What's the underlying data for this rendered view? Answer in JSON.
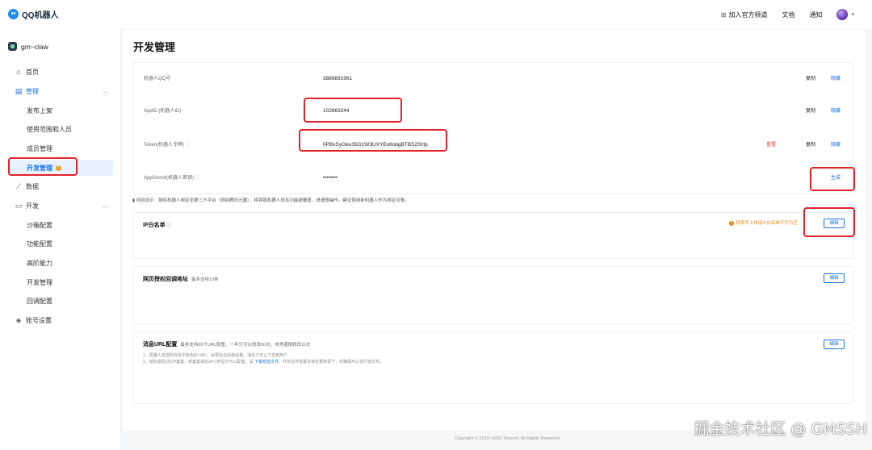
{
  "app": {
    "brand": "QQ机器人"
  },
  "topnav": {
    "join_channel": "加入官方频道",
    "docs": "文档",
    "notifications": "通知"
  },
  "sidebar": {
    "app_name": "gm~claw",
    "items": {
      "home": "首页",
      "manage": "管理",
      "publish": "发布上架",
      "scope": "使用范围和人员",
      "members": "成员管理",
      "dev_manage": "开发管理",
      "data": "数据",
      "dev": "开发",
      "sandbox": "沙箱配置",
      "features": "功能配置",
      "advanced": "高阶能力",
      "dev_manage_2": "开发管理",
      "callback": "回调配置",
      "account": "账号设置"
    },
    "dev_manage_badge": "!"
  },
  "page": {
    "title": "开发管理",
    "fields": [
      {
        "label": "机器人QQ号",
        "value": "3889891961",
        "copy": "复制",
        "hide": "隐藏"
      },
      {
        "label": "AppID (机器人ID)",
        "value": "102863244",
        "copy": "复制",
        "hide": "隐藏"
      },
      {
        "label": "Token(机器人令牌)",
        "value": "0PBxSyOeu35G1W3UXYEx6obgBTBS2SHp",
        "reset": "重置",
        "copy": "复制",
        "hide": "隐藏"
      },
      {
        "label": "AppSecret(机器人密钥)",
        "value": "••••••••",
        "generate": "生成"
      }
    ],
    "risk_warning": "风险提示：授权机器人绑定至第三方平台（例如腾讯元器），将导致机器人现有功能被覆盖，请谨慎操作。建议使用新机器人作为绑定对象。",
    "ip_whitelist": {
      "title": "IP白名单",
      "tip": "频率写上线用IP白名单不可为空",
      "edit": "编辑"
    },
    "web_callback": {
      "title": "网页授权回调地址",
      "note": "最多支持10条",
      "edit": "编辑"
    },
    "msg_url": {
      "title": "消息URL配置",
      "note": "最多支持20个URL配置，一年只可以修改50次，非常谨慎修改以次",
      "line1": "1、机器人发送的消息中包含的 URL，会预先在后端设置。消息才可以下发到用户",
      "line2_prefix": "2、域名需经过ICP备案，新备案域名24小时后才可以配置。请 ",
      "line2_link": "下载校验文件",
      "line2_suffix": "，并将文件放置在域名根目录下，并确保可以访问该文件。",
      "edit": "编辑"
    }
  },
  "footer": "Copyright © 2019~2026 Tencent. All Rights Reserved",
  "watermark": "掘金技术社区 @ GMSSH"
}
